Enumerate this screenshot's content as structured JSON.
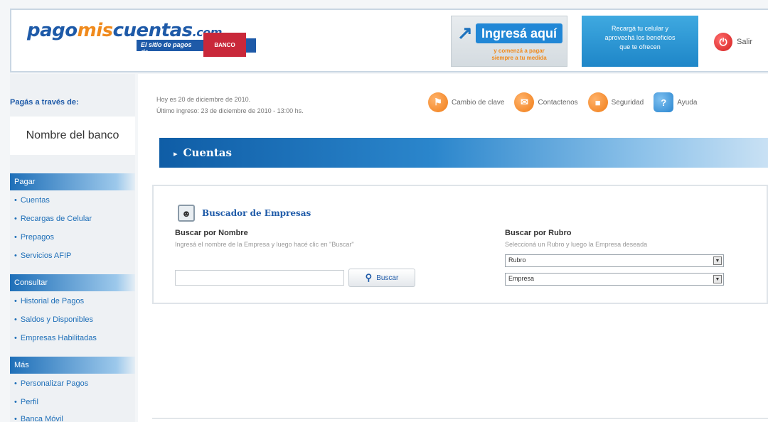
{
  "header": {
    "logo_part1": "pago",
    "logo_part2": "mis",
    "logo_part3": "cuentas",
    "logo_dotcom": ".com",
    "logo_tagline": "El sitio de pagos de",
    "bank_logo_text": "BANCO",
    "banner1_button": "Ingresá aquí",
    "banner1_sub": "y comenzá a pagar\nsiempre a tu medida",
    "banner2_text": "Recargá tu celular y\naprovechá los beneficios\nque te ofrecen",
    "logout_label": "Salir"
  },
  "sidebar": {
    "pay_via_label": "Pagás a través de:",
    "bank_name": "Nombre del banco",
    "sections": [
      {
        "title": "Pagar",
        "items": [
          "Cuentas",
          "Recargas de Celular",
          "Prepagos",
          "Servicios AFIP"
        ]
      },
      {
        "title": "Consultar",
        "items": [
          "Historial de Pagos",
          "Saldos y Disponibles",
          "Empresas Habilitadas"
        ]
      },
      {
        "title": "Más",
        "items": [
          "Personalizar Pagos",
          "Perfil",
          "Banca Móvil"
        ]
      }
    ]
  },
  "main": {
    "date_line1": "Hoy es 20 de diciembre de 2010.",
    "date_line2": "Último ingreso: 23 de diciembre de 2010 - 13:00 hs.",
    "toolbar": {
      "change_key": "Cambio de clave",
      "contacts": "Contactenos",
      "security": "Seguridad",
      "help": "Ayuda"
    },
    "page_title": "Cuentas",
    "panel": {
      "title": "Buscador de Empresas",
      "by_name_label": "Buscar por Nombre",
      "by_name_help": "Ingresá el nombre de la Empresa y luego hacé clic en \"Buscar\"",
      "name_input_value": "",
      "search_button": "Buscar",
      "by_category_label": "Buscar por Rubro",
      "by_category_help": "Seleccioná un Rubro y luego la Empresa deseada",
      "category_select": "Rubro",
      "company_select": "Empresa"
    }
  },
  "colors": {
    "brand_blue": "#1e5aa8",
    "brand_orange": "#f08a1c",
    "accent_red": "#c9283a"
  }
}
